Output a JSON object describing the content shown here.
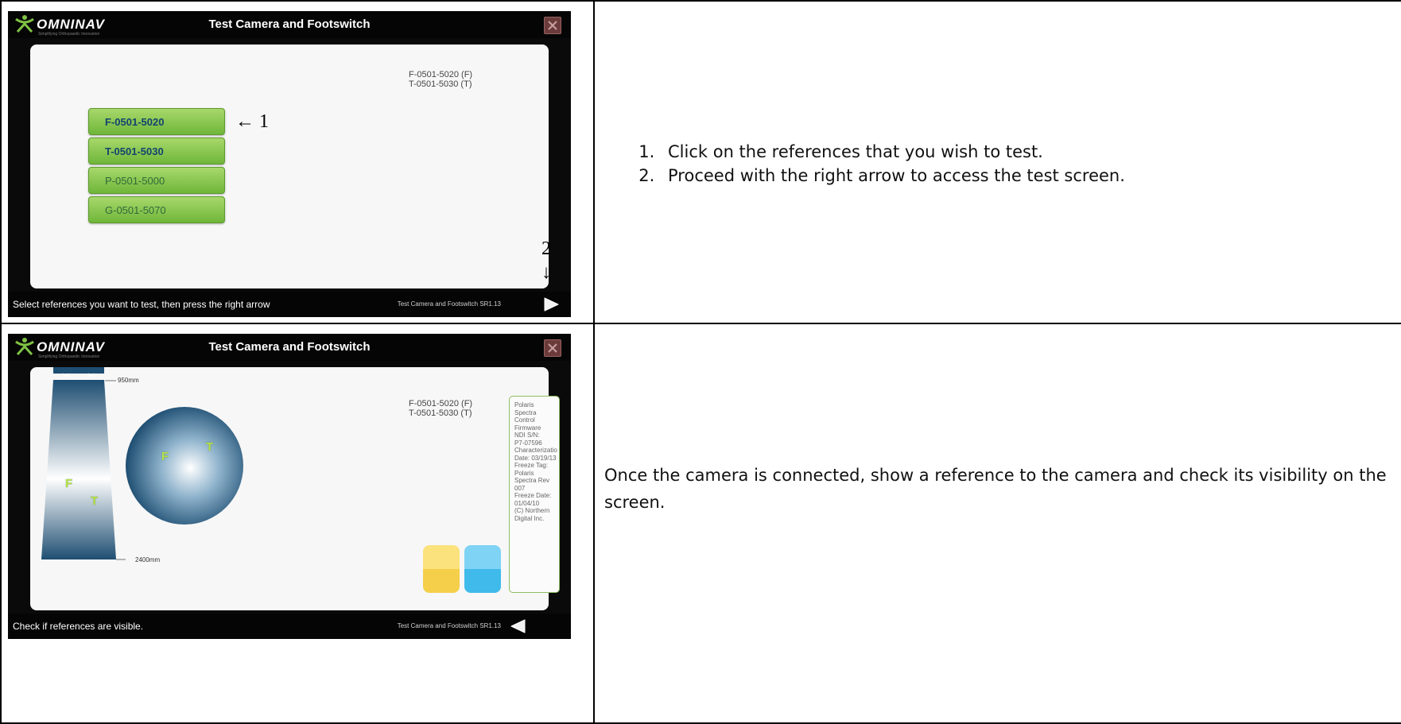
{
  "step1": {
    "app_name": "OMNINAV",
    "app_tagline": "Simplifying Orthopaedic Innovation",
    "window_title": "Test Camera and Footswitch",
    "reference_lines": [
      "F-0501-5020 (F)",
      "T-0501-5030 (T)"
    ],
    "reference_buttons": [
      {
        "label": "F-0501-5020",
        "selected": true
      },
      {
        "label": "T-0501-5030",
        "selected": true
      },
      {
        "label": "P-0501-5000",
        "selected": false
      },
      {
        "label": "G-0501-5070",
        "selected": false
      }
    ],
    "annotation_1": "← 1",
    "annotation_2_number": "2",
    "annotation_2_arrow": "↓",
    "status_text": "Select references you want to test, then press the right arrow",
    "status_version": "Test Camera and Footswitch  SR1.13",
    "instructions": [
      "Click on the references that you wish to test.",
      "Proceed with the right arrow to access the test screen."
    ]
  },
  "step2": {
    "app_name": "OMNINAV",
    "app_tagline": "Simplifying Orthopaedic Innovation",
    "window_title": "Test Camera and Footswitch",
    "reference_lines": [
      "F-0501-5020 (F)",
      "T-0501-5030 (T)"
    ],
    "near_distance": "950mm",
    "far_distance": "2400mm",
    "marker_f": "F",
    "marker_t": "T",
    "camera_info": "Polaris\nSpectra\nControl\nFirmware\nNDI S/N:\nP7-07596\nCharacterizatio\nDate: 03/19/13\nFreeze Tag:\nPolaris\nSpectra Rev\n007\nFreeze Date:\n01/04/10\n(C) Northern\nDigital Inc.",
    "status_text": "Check if references are visible.",
    "status_version": "Test Camera and Footswitch  SR1.13",
    "description": "Once the camera is connected, show a reference to the camera and check its visibility on the screen."
  },
  "colors": {
    "accent_green": "#8cc063",
    "button_green": "#7fc244",
    "swatch_yellow": "#f7d560",
    "swatch_blue": "#4fc2ee",
    "sphere_blue": "#1e4e72"
  }
}
